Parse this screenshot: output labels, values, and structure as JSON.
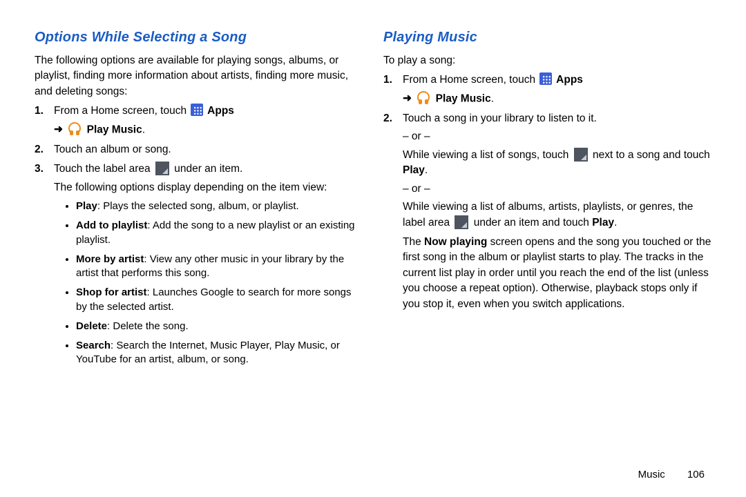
{
  "left": {
    "heading": "Options While Selecting a Song",
    "intro": "The following options are available for playing songs, albums, or playlist, finding more information about artists, finding more music, and deleting songs:",
    "step1_a": "From a Home screen, touch ",
    "apps_label": " Apps",
    "arrow": "➜",
    "playmusic_label": " Play Music",
    "step2": "Touch an album or song.",
    "step3_a": "Touch the label area ",
    "step3_b": " under an item.",
    "step3_sub": "The following options display depending on the item view:",
    "opts": {
      "play_b": "Play",
      "play_t": ": Plays the selected song, album, or playlist.",
      "add_b": "Add to playlist",
      "add_t": ": Add the song to a new playlist or an existing playlist.",
      "more_b": "More by artist",
      "more_t": ": View any other music in your library by the artist that performs this song.",
      "shop_b": "Shop for artist",
      "shop_t": ": Launches Google to search for more songs by the selected artist.",
      "del_b": "Delete",
      "del_t": ": Delete the song.",
      "search_b": "Search",
      "search_t": ": Search the Internet, Music Player, Play Music, or YouTube for an artist, album, or song."
    }
  },
  "right": {
    "heading": "Playing Music",
    "intro": "To play a song:",
    "step1_a": "From a Home screen, touch ",
    "apps_label": " Apps",
    "arrow": "➜",
    "playmusic_label": " Play Music",
    "step2_a": "Touch a song in your library to listen to it.",
    "or": "– or –",
    "step2_b1": "While viewing a list of songs, touch ",
    "step2_b2": " next to a song and touch ",
    "play_b": "Play",
    "step2_c": "While viewing a list of albums, artists, playlists, or genres, the label area ",
    "step2_c2": " under an item and touch ",
    "para_a": "The ",
    "nowplaying_b": "Now playing",
    "para_b": " screen opens and the song you touched or the first song in the album or playlist starts to play. The tracks in the current list play in order until you reach the end of the list (unless you choose a repeat option). Otherwise, playback stops only if you stop it, even when you switch applications."
  },
  "footer": {
    "section": "Music",
    "page": "106"
  }
}
